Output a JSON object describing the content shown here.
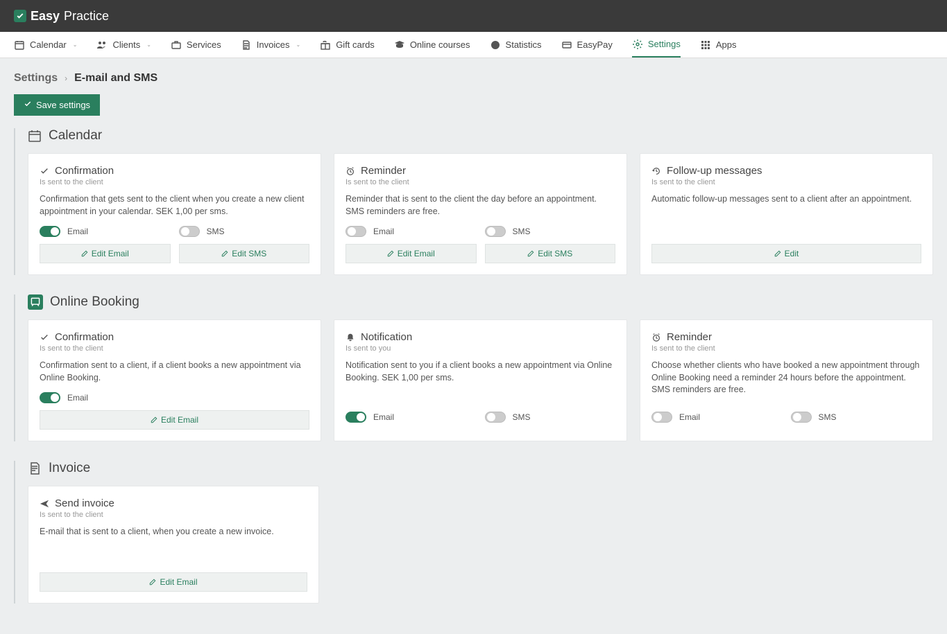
{
  "brand": {
    "strong": "Easy",
    "light": "Practice"
  },
  "nav": {
    "calendar": "Calendar",
    "clients": "Clients",
    "services": "Services",
    "invoices": "Invoices",
    "gift_cards": "Gift cards",
    "online_courses": "Online courses",
    "statistics": "Statistics",
    "easypay": "EasyPay",
    "settings": "Settings",
    "apps": "Apps"
  },
  "breadcrumb": {
    "root": "Settings",
    "current": "E-mail and SMS"
  },
  "save": "Save settings",
  "section_calendar": {
    "title": "Calendar"
  },
  "section_online_booking": {
    "title": "Online Booking"
  },
  "section_invoice": {
    "title": "Invoice"
  },
  "labels": {
    "email": "Email",
    "sms": "SMS",
    "edit_email": "Edit Email",
    "edit_sms": "Edit SMS",
    "edit": "Edit"
  },
  "calendar": {
    "confirmation": {
      "title": "Confirmation",
      "sub": "Is sent to the client",
      "desc": "Confirmation that gets sent to the client when you create a new client appointment in your calendar. SEK 1,00 per sms."
    },
    "reminder": {
      "title": "Reminder",
      "sub": "Is sent to the client",
      "desc": "Reminder that is sent to the client the day before an appointment. SMS reminders are free."
    },
    "followup": {
      "title": "Follow-up messages",
      "sub": "Is sent to the client",
      "desc": "Automatic follow-up messages sent to a client after an appointment."
    }
  },
  "online_booking": {
    "confirmation": {
      "title": "Confirmation",
      "sub": "Is sent to the client",
      "desc": "Confirmation sent to a client, if a client books a new appointment via Online Booking."
    },
    "notification": {
      "title": "Notification",
      "sub": "Is sent to you",
      "desc": "Notification sent to you if a client books a new appointment via Online Booking. SEK 1,00 per sms."
    },
    "reminder": {
      "title": "Reminder",
      "sub": "Is sent to the client",
      "desc": "Choose whether clients who have booked a new appointment through Online Booking need a reminder 24 hours before the appointment. SMS reminders are free."
    }
  },
  "invoice": {
    "send": {
      "title": "Send invoice",
      "sub": "Is sent to the client",
      "desc": "E-mail that is sent to a client, when you create a new invoice."
    }
  }
}
